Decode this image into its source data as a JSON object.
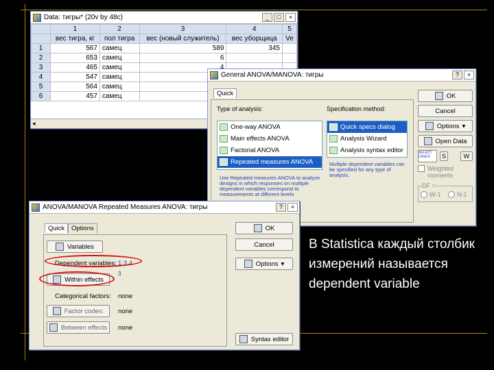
{
  "data_window": {
    "title": "Data: тигры* (20v by 48c)",
    "col_numbers": [
      "1",
      "2",
      "3",
      "4",
      "5"
    ],
    "col_headers": [
      "вес тигра, кг",
      "пол тигра",
      "вес (новый служитель)",
      "вес уборщица",
      "Ve"
    ],
    "rows": [
      {
        "n": "1",
        "c1": "567",
        "c2": "самец",
        "c3": "589",
        "c4": "345"
      },
      {
        "n": "2",
        "c1": "653",
        "c2": "самец",
        "c3": "6",
        "c4": ""
      },
      {
        "n": "3",
        "c1": "465",
        "c2": "самец",
        "c3": "4",
        "c4": ""
      },
      {
        "n": "4",
        "c1": "547",
        "c2": "самец",
        "c3": "5",
        "c4": ""
      },
      {
        "n": "5",
        "c1": "564",
        "c2": "самец",
        "c3": "5",
        "c4": ""
      },
      {
        "n": "6",
        "c1": "457",
        "c2": "самец",
        "c3": "4",
        "c4": ""
      }
    ]
  },
  "general_window": {
    "title": "General ANOVA/MANOVA: тигры",
    "tab_quick": "Quick",
    "type_label": "Type of analysis:",
    "spec_label": "Specification method:",
    "types": [
      "One-way ANOVA",
      "Main effects ANOVA",
      "Factorial ANOVA",
      "Repeated measures ANOVA"
    ],
    "specs": [
      "Quick specs dialog",
      "Analysis Wizard",
      "Analysis syntax editor"
    ],
    "desc_left": "Use Repeated measures ANOVA to analyze designs in which responses on multiple dependent variables correspond to measurements at different levels",
    "desc_right": "Multiple dependent variables can be specified for any type of analysis.",
    "ok": "OK",
    "cancel": "Cancel",
    "options": "Options",
    "open_data": "Open Data",
    "select_cases": "SELECT CASES",
    "s_label": "S",
    "w_label": "W",
    "weighted": "Weighted moments",
    "df_label": "DF =",
    "w1": "W-1",
    "n1": "N-1"
  },
  "repeated_window": {
    "title": "ANOVA/MANOVA Repeated Measures ANOVA: тигры",
    "tab_quick": "Quick",
    "tab_options": "Options",
    "variables": "Variables",
    "dep_vars_label": "Dependent variables:",
    "dep_vars_value": "1 3 4",
    "within_effects": "Within effects",
    "within_value": "3",
    "cat_factors": "Categorical factors:",
    "cat_value": "none",
    "factor_codes": "Factor codes:",
    "factor_value": "none",
    "between_effects": "Between effects",
    "between_value": "none",
    "ok": "OK",
    "cancel": "Cancel",
    "options": "Options",
    "syntax_editor": "Syntax editor"
  },
  "caption": "В Statistica каждый столбик измерений называется dependent variable"
}
